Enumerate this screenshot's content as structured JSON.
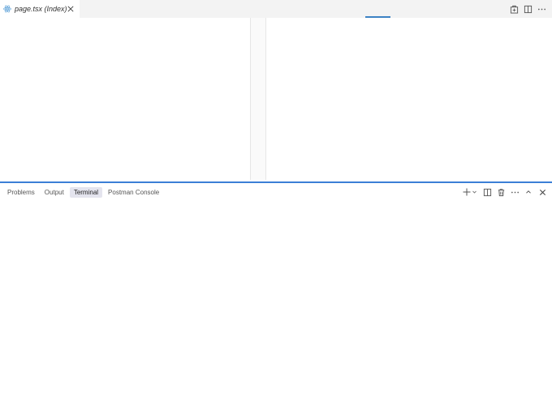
{
  "editor": {
    "tab": {
      "label": "page.tsx (Index)",
      "icon": "react-icon"
    },
    "actions": [
      "open-changes-icon",
      "split-editor-icon",
      "more-actions-icon"
    ]
  },
  "panel": {
    "tabs": [
      {
        "label": "Problems",
        "active": false
      },
      {
        "label": "Output",
        "active": false
      },
      {
        "label": "Terminal",
        "active": true
      },
      {
        "label": "Postman Console",
        "active": false
      }
    ],
    "actions": [
      "new-terminal-icon",
      "split-terminal-icon",
      "kill-terminal-icon",
      "more-actions-icon",
      "maximize-panel-icon",
      "close-panel-icon"
    ]
  },
  "colors": {
    "accent": "#3c7fd6",
    "react": "#5aa0d8",
    "active_tab_bg": "#e4e4ee"
  }
}
